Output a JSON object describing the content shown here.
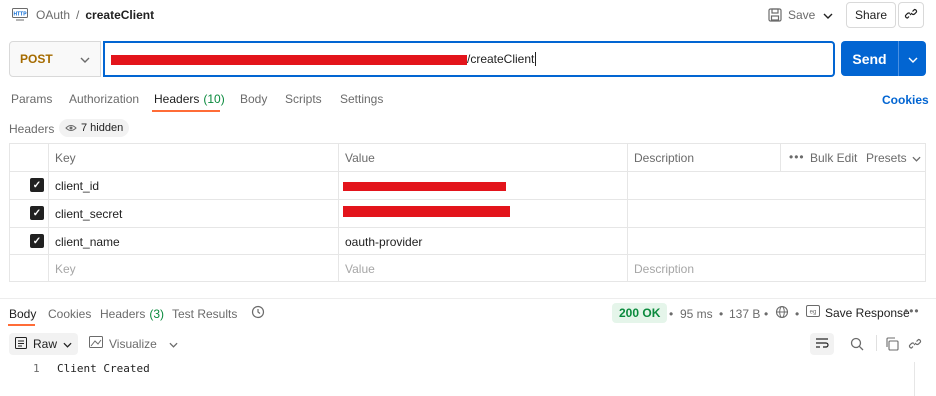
{
  "breadcrumb": {
    "collection": "OAuth",
    "separator": "/",
    "request": "createClient"
  },
  "toolbar": {
    "save_label": "Save",
    "share_label": "Share"
  },
  "request": {
    "method": "POST",
    "url_suffix": "/createClient",
    "send_label": "Send"
  },
  "tabs": [
    {
      "label": "Params"
    },
    {
      "label": "Authorization"
    },
    {
      "label": "Headers",
      "count": "(10)"
    },
    {
      "label": "Body"
    },
    {
      "label": "Scripts"
    },
    {
      "label": "Settings"
    }
  ],
  "cookies_link": "Cookies",
  "headers_section": {
    "title": "Headers",
    "hidden": "7 hidden"
  },
  "table": {
    "columns": {
      "key": "Key",
      "value": "Value",
      "description": "Description"
    },
    "actions": {
      "bulk_edit": "Bulk Edit",
      "presets": "Presets"
    },
    "rows": [
      {
        "key": "client_id",
        "value": "",
        "checked": true
      },
      {
        "key": "client_secret",
        "value": "",
        "checked": true
      },
      {
        "key": "client_name",
        "value": "oauth-provider",
        "checked": true
      }
    ],
    "placeholders": {
      "key": "Key",
      "value": "Value",
      "description": "Description"
    }
  },
  "response": {
    "tabs": [
      {
        "label": "Body"
      },
      {
        "label": "Cookies"
      },
      {
        "label": "Headers",
        "count": "(3)"
      },
      {
        "label": "Test Results"
      }
    ],
    "status": "200 OK",
    "time": "95 ms",
    "size": "137 B",
    "save_response": "Save Response",
    "format": "Raw",
    "visualize": "Visualize",
    "line_number": "1",
    "body_text": "Client Created"
  },
  "colors": {
    "accent": "#0265d2",
    "tab_underline": "#ff6c37",
    "method": "#a56b00",
    "ok_green": "#0a8a3d",
    "redaction": "#e3141b"
  },
  "icons": [
    "http-icon",
    "save-icon",
    "chevron-down-icon",
    "link-icon",
    "eye-icon",
    "more-icon",
    "history-icon",
    "globe-icon",
    "save-response-icon",
    "raw-icon",
    "visualize-icon",
    "wrap-icon",
    "search-icon",
    "copy-icon"
  ]
}
